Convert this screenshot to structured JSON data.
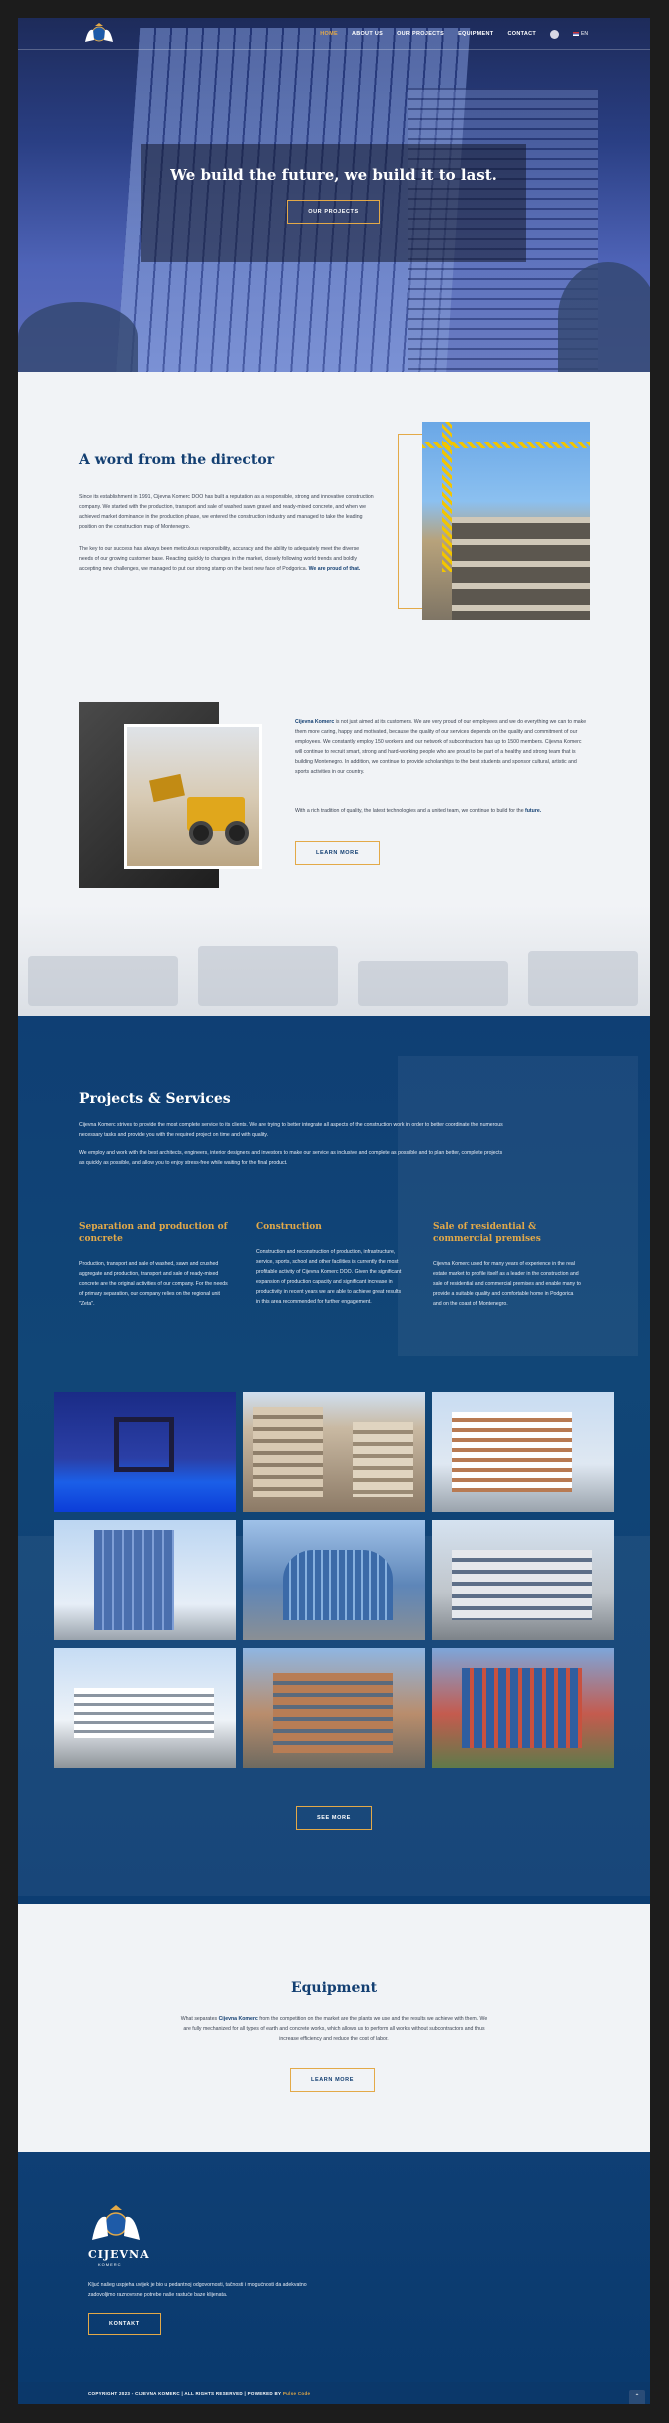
{
  "nav": {
    "items": [
      "HOME",
      "ABOUT US",
      "OUR PROJECTS",
      "EQUIPMENT",
      "CONTACT"
    ],
    "lang": "EN"
  },
  "hero": {
    "title": "We build the future, we build it to last.",
    "button": "OUR PROJECTS"
  },
  "director": {
    "title": "A word from the director",
    "p1": "Since its establishment in 1991, Cijevna Komerc DOO has built a reputation as a responsible, strong and innovative construction company. We started with the production, transport and sale of washed sawn gravel and ready-mixed concrete, and when we achieved market dominance in the production phase, we entered the construction industry and managed to take the leading position on the construction map of Montenegro.",
    "p2_main": "The key to our success has always been meticulous responsibility, accuracy and the ability to adequately meet the diverse needs of our growing customer base. Reacting quickly to changes in the market, closely following world trends and boldly accepting new challenges, we managed to put our strong stamp on the best new face of Podgorica.",
    "p2_bold": "We are proud of that.",
    "p3_bold": "Cijevna Komerc",
    "p3_main": "is not just aimed at its customers. We are very proud of our employees and we do everything we can to make them more caring, happy and motivated, because the quality of our services depends on the quality and commitment of our employees. We constantly employ 150 workers and our network of subcontractors has up to 1500 members. Cijevna Komerc will continue to recruit smart, strong and hard-working people who are proud to be part of a healthy and strong team that is building Montenegro. In addition, we continue to provide scholarships to the best students and sponsor cultural, artistic and sports activities in our country.",
    "p4_main": "With a rich tradition of quality, the latest technologies and a united team, we continue to build for the",
    "p4_bold": "future.",
    "button": "LEARN MORE"
  },
  "projects": {
    "title": "Projects & Services",
    "intro1": "Cijevna Komerc strives to provide the most complete service to its clients. We are trying to better integrate all aspects of the construction work in order to better coordinate the numerous necessary tasks and provide you with the required project on time and with quality.",
    "intro2": "We employ and work with the best architects, engineers, interior designers and investors to make our service as inclusive and complete as possible and to plan better, complete projects as quickly as possible, and allow you to enjoy stress-free while waiting for the final product.",
    "services": [
      {
        "title": "Separation and production of concrete",
        "text": "Production, transport and sale of washed, sawn and crushed aggregate and production, transport and sale of ready-mixed concrete are the original activities of our company. For the needs of primary separation, our company relies on the regional unit \"Zeta\"."
      },
      {
        "title": "Construction",
        "text": "Construction and reconstruction of production, infrastructure, service, sports, school and other facilities is currently the most profitable activity of Cijevna Komerc DOO. Given the significant expansion of production capacity and significant increase in productivity in recent years we are able to achieve great results in this area recommended for further engagement."
      },
      {
        "title": "Sale of residential & commercial premises",
        "text": "Cijevna Komerc used for many years of experience in the real estate market to profile itself as a leader in the construction and sale of residential and commercial premises and enable many to provide a suitable quality and comfortable home in Podgorica and on the coast of Montenegro."
      }
    ],
    "button": "SEE MORE"
  },
  "equipment": {
    "title": "Equipment",
    "text_pre": "What separates",
    "text_bold": "Cijevna Komerc",
    "text_post": "from the competition on the market are the plants we use and the results we achieve with them. We are fully mechanized for all types of earth and concrete works, which allows us to perform all works without subcontractors and thus increase efficiency and reduce the cost of labor.",
    "button": "LEARN MORE"
  },
  "footer": {
    "brand": "CIJEVNA",
    "brand_sub": "KOMERC",
    "text": "Kljuć našeg uspjeha uvijek je bio u pedantnoj odgovornosti, tačnosti i mogućnosti da adekvatno zadovoljimo raznovrsne potrebe naše rastuće baze klijenata.",
    "button": "KONTAKT",
    "copyright": "COPYRIGHT 2023 - CIJEVNA KOMERC   |   ALL RIGHTS RESERVED   |   POWERED BY",
    "powered": "Pulse Code"
  },
  "colors": {
    "navy": "#133f72",
    "blue_bg": "#0f3f74",
    "gold": "#e3a948",
    "light_bg": "#f1f3f6"
  },
  "icons": [
    "logo-lions-crest",
    "search-icon",
    "flag-icon",
    "arrow-up-icon"
  ]
}
